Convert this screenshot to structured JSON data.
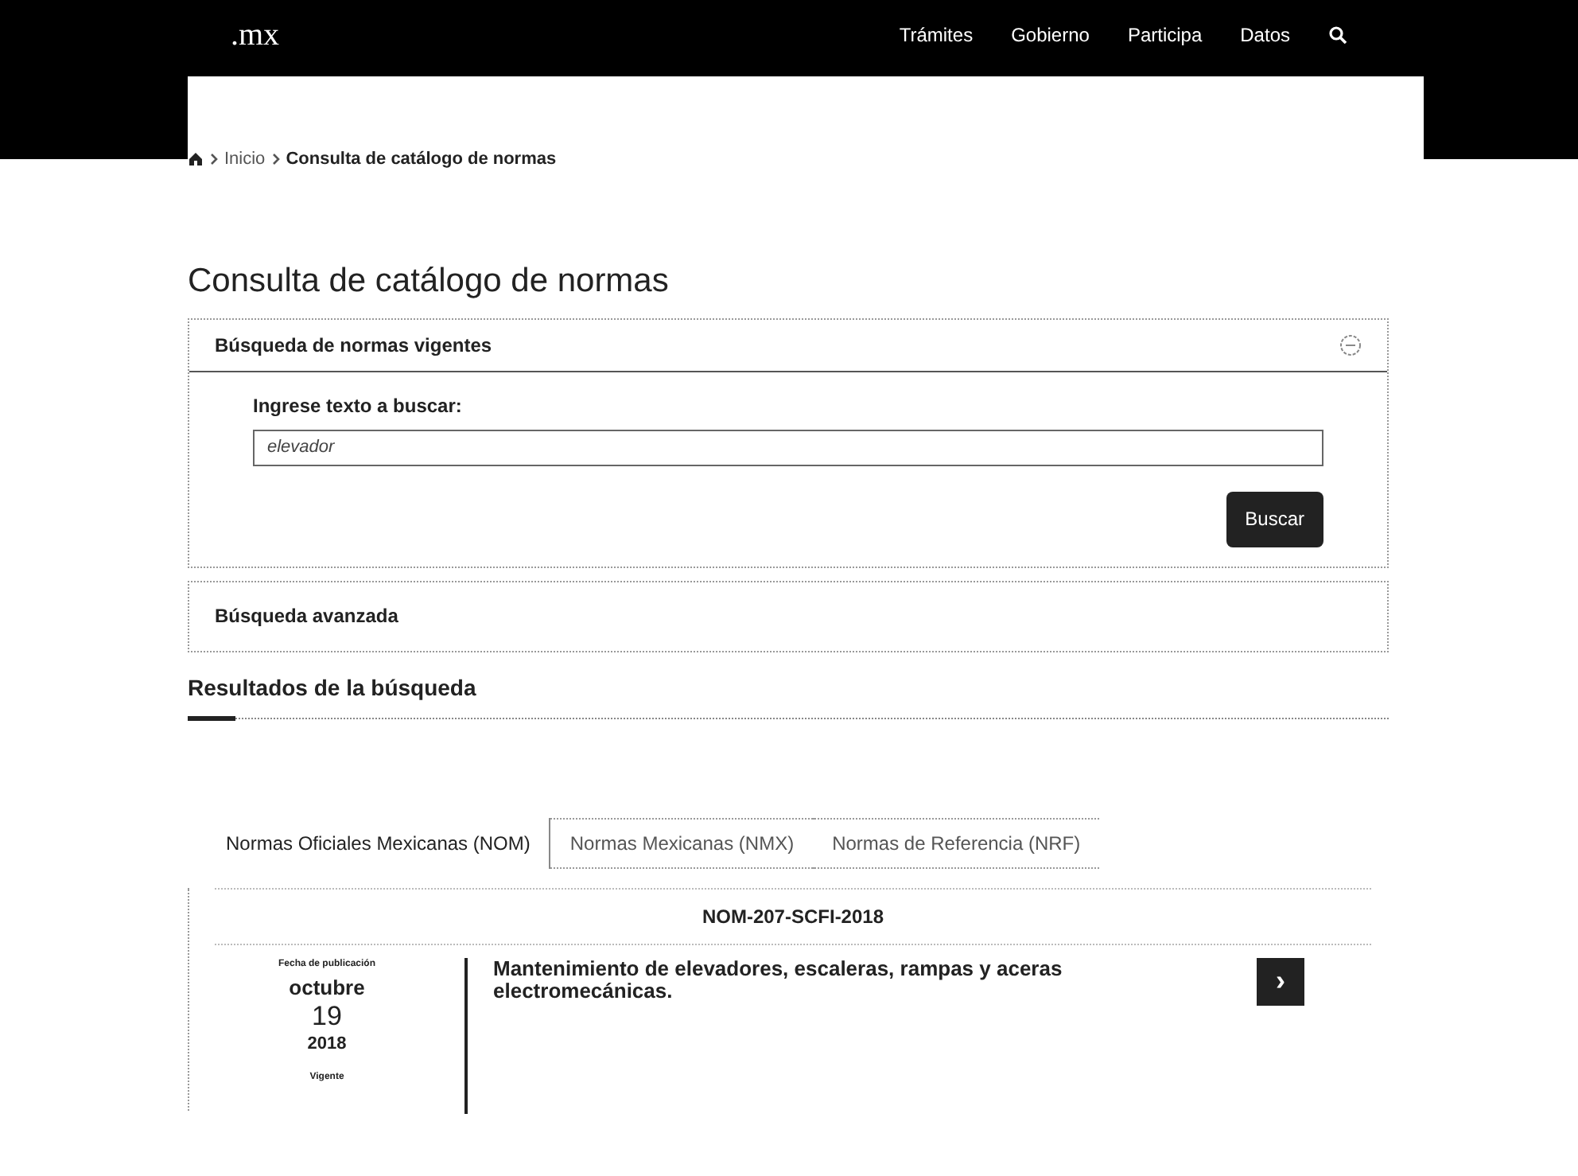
{
  "header": {
    "logo": ".mx",
    "nav": [
      "Trámites",
      "Gobierno",
      "Participa",
      "Datos"
    ]
  },
  "breadcrumb": [
    "Inicio",
    "Consulta de catálogo de normas"
  ],
  "title": "Consulta de catálogo de normas",
  "search_panel": {
    "heading": "Búsqueda de normas vigentes",
    "expanded": true,
    "label": "Ingrese texto a buscar:",
    "value": "elevador",
    "button": "Buscar"
  },
  "advanced": {
    "heading": "Búsqueda avanzada"
  },
  "results": {
    "heading": "Resultados de la búsqueda",
    "tabs": [
      {
        "label": "Normas Oficiales Mexicanas (NOM)",
        "selected": true
      },
      {
        "label": "Normas Mexicanas (NMX)",
        "selected": false
      },
      {
        "label": "Normas de Referencia (NRF)",
        "selected": false
      }
    ],
    "items": [
      {
        "code": "NOM-207-SCFI-2018",
        "date_label": "Fecha de publicación",
        "month": "octubre",
        "day": "19",
        "year": "2018",
        "status": "Vigente",
        "description": "Mantenimiento de elevadores, escaleras, rampas y aceras electromecánicas.",
        "button": "›"
      }
    ]
  }
}
